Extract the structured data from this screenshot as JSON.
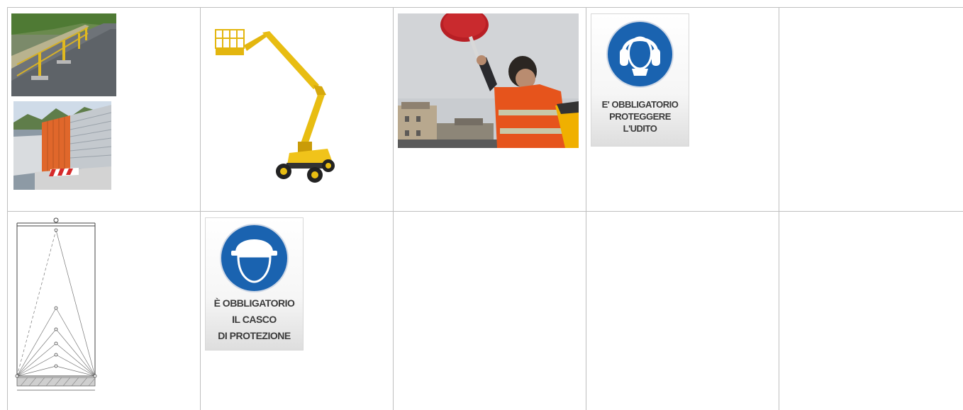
{
  "table": {
    "rows": 2,
    "columns": 5,
    "border_color": "#bfbfbf"
  },
  "images": [
    {
      "name": "road-barrier-photo",
      "row": 1,
      "col": 1
    },
    {
      "name": "noise-barrier-fence-photo",
      "row": 1,
      "col": 1
    },
    {
      "name": "aerial-work-platform-photo",
      "row": 1,
      "col": 2
    },
    {
      "name": "flagman-stop-paddle-photo",
      "row": 1,
      "col": 3
    },
    {
      "name": "hearing-protection-sign",
      "row": 1,
      "col": 4
    },
    {
      "name": "load-distribution-diagram",
      "row": 2,
      "col": 1
    },
    {
      "name": "hard-hat-sign",
      "row": 2,
      "col": 2
    }
  ],
  "signs": {
    "hearing": {
      "line1": "E' OBBLIGATORIO",
      "line2": "PROTEGGERE",
      "line3": "L'UDITO",
      "icon": "ear-protection-icon",
      "color": "#1a63b0"
    },
    "helmet": {
      "line1": "È OBBLIGATORIO",
      "line2": "IL CASCO",
      "line3": "DI PROTEZIONE",
      "icon": "hard-hat-icon",
      "color": "#1a63b0"
    }
  }
}
